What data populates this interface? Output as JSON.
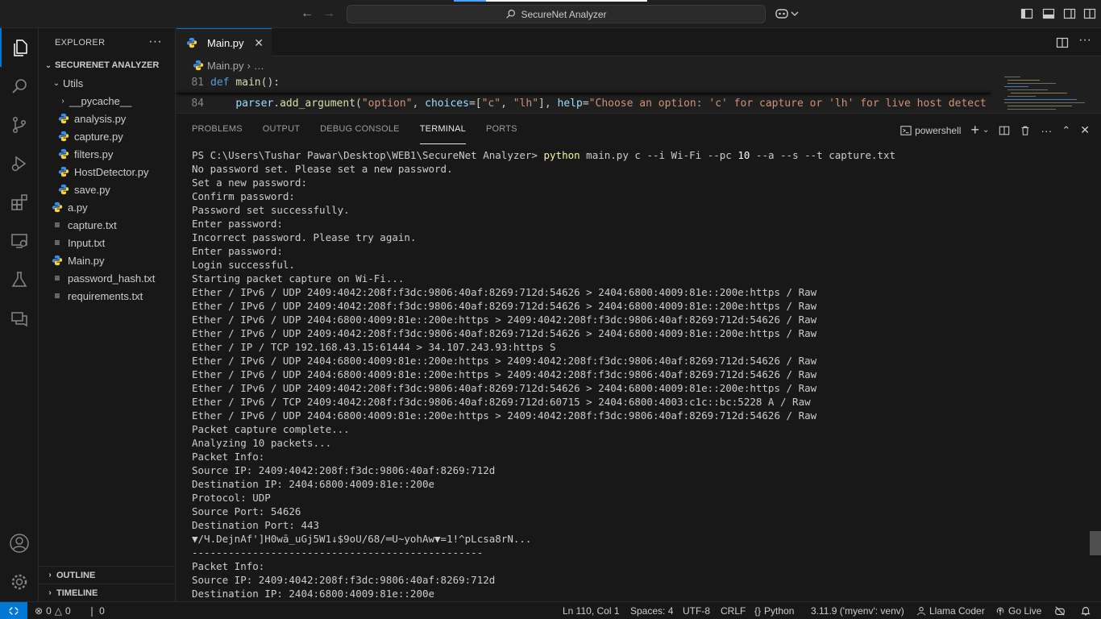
{
  "titlebar": {
    "search_text": "SecureNet Analyzer",
    "back_icon": "arrow-left-icon",
    "forward_icon": "arrow-right-icon"
  },
  "activity_bar": {
    "items": [
      "explorer-icon",
      "search-icon",
      "source-control-icon",
      "run-debug-icon",
      "extensions-icon",
      "remote-explorer-icon",
      "testing-icon",
      "chat-icon"
    ],
    "bottom": [
      "account-icon",
      "settings-icon"
    ]
  },
  "sidebar": {
    "title": "EXPLORER",
    "more": "···",
    "project": "SECURENET ANALYZER",
    "folder": "Utils",
    "subfolder": "__pycache__",
    "utils_files": [
      "analysis.py",
      "capture.py",
      "filters.py",
      "HostDetector.py",
      "save.py"
    ],
    "root_files": [
      {
        "name": "a.py",
        "type": "py"
      },
      {
        "name": "capture.txt",
        "type": "txt"
      },
      {
        "name": "Input.txt",
        "type": "txt"
      },
      {
        "name": "Main.py",
        "type": "py"
      },
      {
        "name": "password_hash.txt",
        "type": "txt"
      },
      {
        "name": "requirements.txt",
        "type": "txt"
      }
    ],
    "outline": "OUTLINE",
    "timeline": "TIMELINE"
  },
  "editor": {
    "tab_label": "Main.py",
    "tab_close": "✕",
    "breadcrumb_file": "Main.py",
    "breadcrumb_rest": "…",
    "line1_num": "81",
    "line1_kw": "def",
    "line1_fn": "main",
    "line1_rest": "():",
    "line2_num": "84",
    "line2_indent": "    ",
    "line2_obj": "parser",
    "line2_method": "add_argument",
    "line2_str1": "\"option\"",
    "line2_kwarg1": "choices",
    "line2_str2": "\"c\"",
    "line2_str3": "\"lh\"",
    "line2_kwarg2": "help",
    "line2_str4": "\"Choose an option: 'c' for capture or 'lh' for live host detect"
  },
  "panel": {
    "tabs": [
      "PROBLEMS",
      "OUTPUT",
      "DEBUG CONSOLE",
      "TERMINAL",
      "PORTS"
    ],
    "active_tab": "TERMINAL",
    "shell": "powershell",
    "prompt": "PS C:\\Users\\Tushar Pawar\\Desktop\\WEB1\\SecureNet Analyzer> ",
    "command_word": "python",
    "command_rest_a": " main.py c --i Wi-Fi --pc ",
    "command_num": "10",
    "command_rest_b": " --a --s --t capture.txt",
    "output_lines": [
      "No password set. Please set a new password.",
      "Set a new password:",
      "Confirm password:",
      "Password set successfully.",
      "Enter password:",
      "Incorrect password. Please try again.",
      "Enter password:",
      "Login successful.",
      "Starting packet capture on Wi-Fi...",
      "Ether / IPv6 / UDP 2409:4042:208f:f3dc:9806:40af:8269:712d:54626 > 2404:6800:4009:81e::200e:https / Raw",
      "Ether / IPv6 / UDP 2409:4042:208f:f3dc:9806:40af:8269:712d:54626 > 2404:6800:4009:81e::200e:https / Raw",
      "Ether / IPv6 / UDP 2404:6800:4009:81e::200e:https > 2409:4042:208f:f3dc:9806:40af:8269:712d:54626 / Raw",
      "Ether / IPv6 / UDP 2409:4042:208f:f3dc:9806:40af:8269:712d:54626 > 2404:6800:4009:81e::200e:https / Raw",
      "Ether / IP / TCP 192.168.43.15:61444 > 34.107.243.93:https S",
      "Ether / IPv6 / UDP 2404:6800:4009:81e::200e:https > 2409:4042:208f:f3dc:9806:40af:8269:712d:54626 / Raw",
      "Ether / IPv6 / UDP 2404:6800:4009:81e::200e:https > 2409:4042:208f:f3dc:9806:40af:8269:712d:54626 / Raw",
      "Ether / IPv6 / UDP 2409:4042:208f:f3dc:9806:40af:8269:712d:54626 > 2404:6800:4009:81e::200e:https / Raw",
      "Ether / IPv6 / TCP 2409:4042:208f:f3dc:9806:40af:8269:712d:60715 > 2404:6800:4003:c1c::bc:5228 A / Raw",
      "Ether / IPv6 / UDP 2404:6800:4009:81e::200e:https > 2409:4042:208f:f3dc:9806:40af:8269:712d:54626 / Raw",
      "Packet capture complete...",
      "Analyzing 10 packets...",
      "Packet Info:",
      "Source IP: 2409:4042:208f:f3dc:9806:40af:8269:712d",
      "Destination IP: 2404:6800:4009:81e::200e",
      "Protocol: UDP",
      "Source Port: 54626",
      "Destination Port: 443",
      "▼/Ч.DejnAf']H0wā_uGj5W1↓$9oU/68/═U~yohAw▼=1!^pLcsa8rN...",
      "------------------------------------------------",
      "Packet Info:",
      "Source IP: 2409:4042:208f:f3dc:9806:40af:8269:712d",
      "Destination IP: 2404:6800:4009:81e::200e"
    ]
  },
  "statusbar": {
    "errors": "0",
    "warnings": "0",
    "ports": "0",
    "position": "Ln 110, Col 1",
    "spaces": "Spaces: 4",
    "encoding": "UTF-8",
    "eol": "CRLF",
    "language_braces": "{}",
    "language": "Python",
    "interpreter": "3.11.9 ('myenv': venv)",
    "llama": "Llama Coder",
    "golive": "Go Live"
  },
  "colors": {
    "accent": "#0078d4",
    "background": "#1f1f1f",
    "sidebar_bg": "#181818",
    "python_icon": "#3b8eea"
  }
}
